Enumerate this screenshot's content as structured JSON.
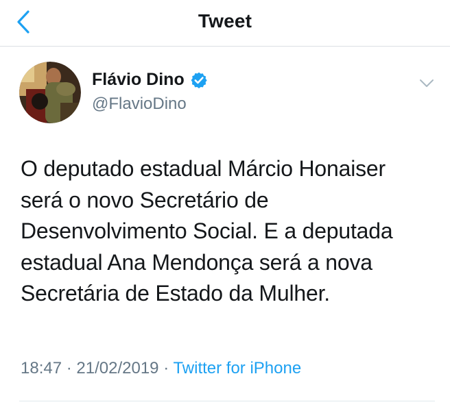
{
  "header": {
    "title": "Tweet",
    "back_icon": "chevron-left-icon"
  },
  "author": {
    "name": "Flávio Dino",
    "handle": "@FlavioDino",
    "verified_icon": "verified-badge-icon",
    "menu_icon": "chevron-down-icon"
  },
  "tweet": {
    "lines": [
      "O deputado estadual Márcio Honaiser",
      "será o novo Secretário de",
      "Desenvolvimento Social. E a deputada",
      "estadual Ana Mendonça será a nova",
      "Secretária de Estado da Mulher."
    ],
    "time": "18:47",
    "date": "21/02/2019",
    "separator": "·",
    "source": "Twitter for iPhone"
  },
  "colors": {
    "accent": "#1da1f2",
    "text": "#14171a",
    "muted": "#657786",
    "divider": "#e1e8ed"
  }
}
